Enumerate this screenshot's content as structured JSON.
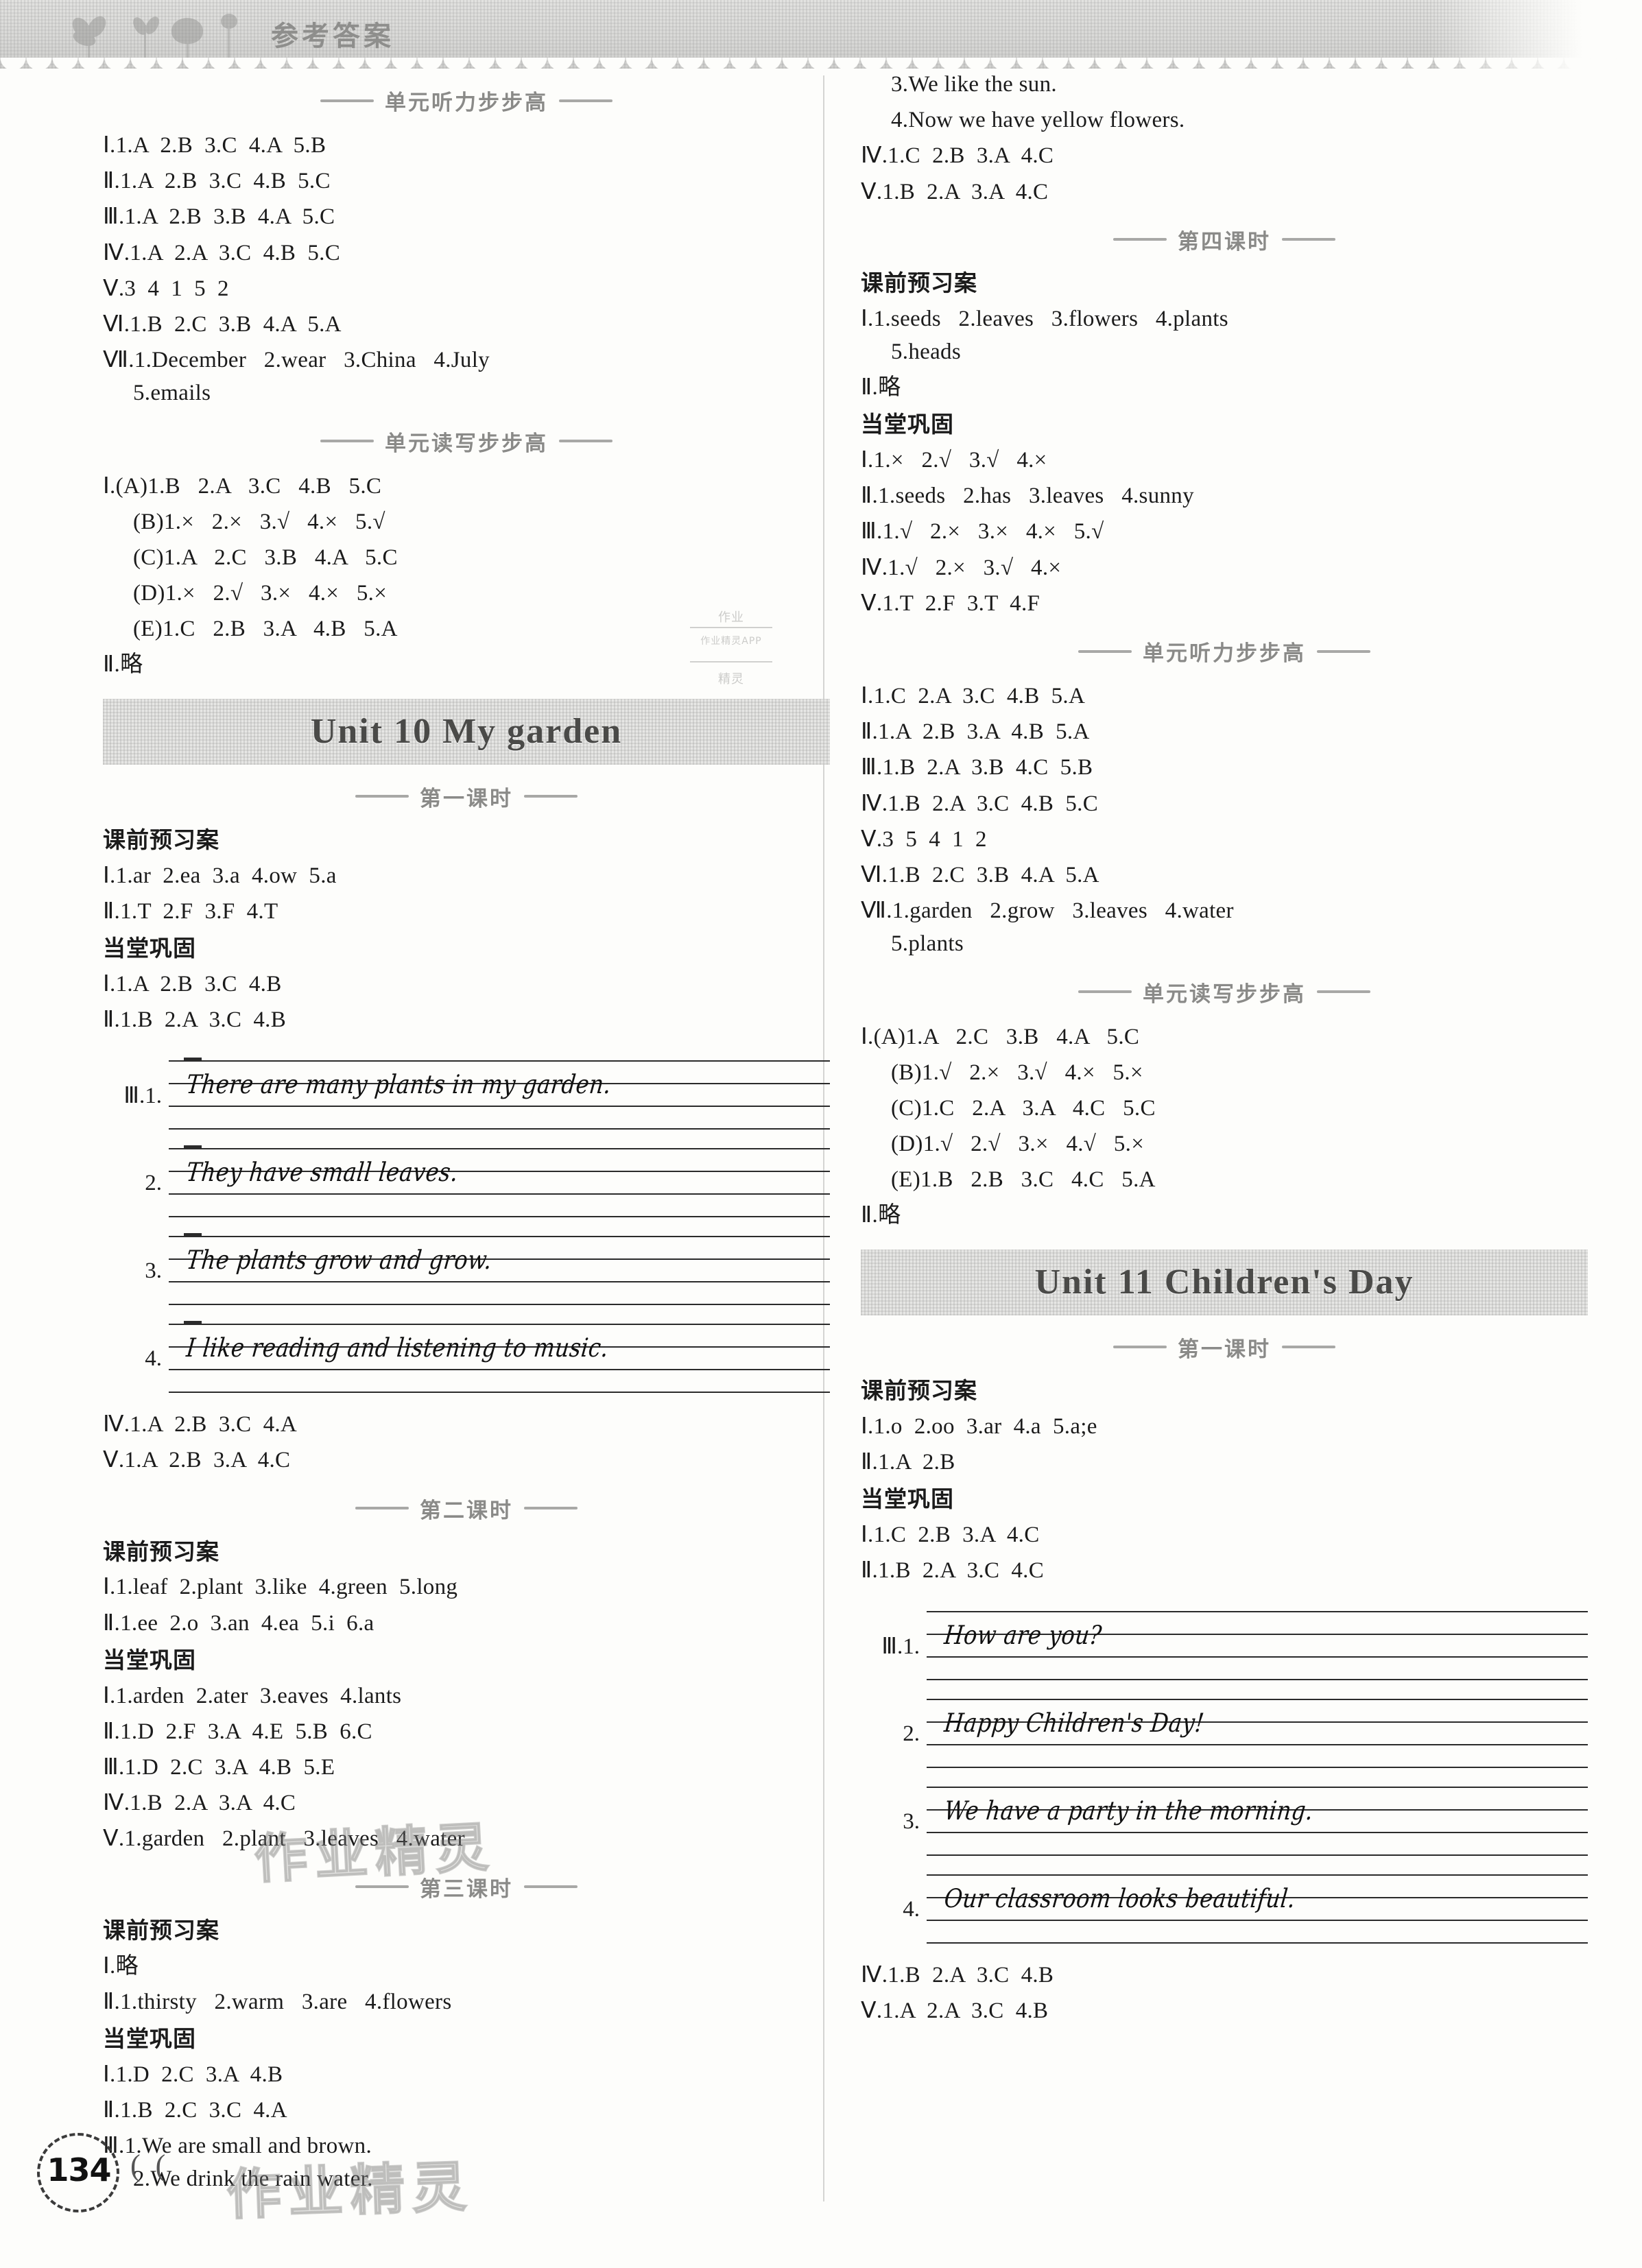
{
  "band": {
    "title": "参考答案"
  },
  "page_number": "134",
  "section_headings": {
    "listening": "单元听力步步高",
    "reading_writing": "单元读写步步高",
    "lesson1": "第一课时",
    "lesson2": "第二课时",
    "lesson3": "第三课时",
    "lesson4": "第四课时"
  },
  "labels": {
    "preview": "课前预习案",
    "consolidate": "当堂巩固"
  },
  "units": {
    "unit10": "Unit 10   My garden",
    "unit11": "Unit 11   Children's Day"
  },
  "left_column": {
    "listening_block": [
      "Ⅰ.1.A  2.B  3.C  4.A  5.B",
      "Ⅱ.1.A  2.B  3.C  4.B  5.C",
      "Ⅲ.1.A  2.B  3.B  4.A  5.C",
      "Ⅳ.1.A  2.A  3.C  4.B  5.C",
      "Ⅴ.3  4  1  5  2",
      "Ⅵ.1.B  2.C  3.B  4.A  5.A",
      "Ⅶ.1.December   2.wear   3.China   4.July"
    ],
    "listening_block_cont": "5.emails",
    "reading_block": [
      "Ⅰ.(A)1.B   2.A   3.C   4.B   5.C",
      "(B)1.×   2.×   3.√   4.×   5.√",
      "(C)1.A   2.C   3.B   4.A   5.C",
      "(D)1.×   2.√   3.×   4.×   5.×",
      "(E)1.C   2.B   3.A   4.B   5.A"
    ],
    "reading_block_tail": "Ⅱ.略",
    "u10_l1_preview": [
      "Ⅰ.1.ar  2.ea  3.a  4.ow  5.a",
      "Ⅱ.1.T  2.F  3.F  4.T"
    ],
    "u10_l1_consolidate": [
      "Ⅰ.1.A  2.B  3.C  4.B",
      "Ⅱ.1.B  2.A  3.C  4.B"
    ],
    "u10_l1_writing_marker": "Ⅲ.1.",
    "u10_l1_writing": [
      {
        "num": "Ⅲ.1.",
        "text": "There are many plants in my garden."
      },
      {
        "num": "2.",
        "text": "They have small leaves."
      },
      {
        "num": "3.",
        "text": "The plants grow and grow."
      },
      {
        "num": "4.",
        "text": "I like reading and listening to music."
      }
    ],
    "u10_l1_after": [
      "Ⅳ.1.A  2.B  3.C  4.A",
      "Ⅴ.1.A  2.B  3.A  4.C"
    ],
    "u10_l2_preview": [
      "Ⅰ.1.leaf  2.plant  3.like  4.green  5.long",
      "Ⅱ.1.ee  2.o  3.an  4.ea  5.i  6.a"
    ],
    "u10_l2_consolidate": [
      "Ⅰ.1.arden  2.ater  3.eaves  4.lants",
      "Ⅱ.1.D  2.F  3.A  4.E  5.B  6.C",
      "Ⅲ.1.D  2.C  3.A  4.B  5.E",
      "Ⅳ.1.B  2.A  3.A  4.C",
      "Ⅴ.1.garden   2.plant   3.leaves   4.water"
    ],
    "u10_l3_preview": [
      "Ⅰ.略",
      "Ⅱ.1.thirsty   2.warm   3.are   4.flowers"
    ],
    "u10_l3_consolidate": [
      "Ⅰ.1.D  2.C  3.A  4.B",
      "Ⅱ.1.B  2.C  3.C  4.A",
      "Ⅲ.1.We are small and brown."
    ],
    "u10_l3_consolidate_cont": "2.We drink the rain water."
  },
  "right_column": {
    "u10_l3_cont": [
      "3.We like the sun.",
      "4.Now we have yellow flowers."
    ],
    "u10_l3_tail": [
      "Ⅳ.1.C  2.B  3.A  4.C",
      "Ⅴ.1.B  2.A  3.A  4.C"
    ],
    "u10_l4_preview": [
      "Ⅰ.1.seeds   2.leaves   3.flowers   4.plants",
      "5.heads",
      "Ⅱ.略"
    ],
    "u10_l4_consolidate": [
      "Ⅰ.1.×   2.√   3.√   4.×",
      "Ⅱ.1.seeds   2.has   3.leaves   4.sunny",
      "Ⅲ.1.√   2.×   3.×   4.×   5.√",
      "Ⅳ.1.√   2.×   3.√   4.×",
      "Ⅴ.1.T  2.F  3.T  4.F"
    ],
    "u10_listening": [
      "Ⅰ.1.C  2.A  3.C  4.B  5.A",
      "Ⅱ.1.A  2.B  3.A  4.B  5.A",
      "Ⅲ.1.B  2.A  3.B  4.C  5.B",
      "Ⅳ.1.B  2.A  3.C  4.B  5.C",
      "Ⅴ.3  5  4  1  2",
      "Ⅵ.1.B  2.C  3.B  4.A  5.A",
      "Ⅶ.1.garden   2.grow   3.leaves   4.water"
    ],
    "u10_listening_cont": "5.plants",
    "u10_reading": [
      "Ⅰ.(A)1.A   2.C   3.B   4.A   5.C",
      "(B)1.√   2.×   3.√   4.×   5.×",
      "(C)1.C   2.A   3.A   4.C   5.C",
      "(D)1.√   2.√   3.×   4.√   5.×",
      "(E)1.B   2.B   3.C   4.C   5.A"
    ],
    "u10_reading_tail": "Ⅱ.略",
    "u11_l1_preview": [
      "Ⅰ.1.o  2.oo  3.ar  4.a  5.a;e",
      "Ⅱ.1.A  2.B"
    ],
    "u11_l1_consolidate": [
      "Ⅰ.1.C  2.B  3.A  4.C",
      "Ⅱ.1.B  2.A  3.C  4.C"
    ],
    "u11_l1_writing": [
      {
        "num": "Ⅲ.1.",
        "text": "How are you?"
      },
      {
        "num": "2.",
        "text": "Happy Children's Day!"
      },
      {
        "num": "3.",
        "text": "We have a party in the morning."
      },
      {
        "num": "4.",
        "text": "Our classroom looks beautiful."
      }
    ],
    "u11_l1_after": [
      "Ⅳ.1.B  2.A  3.C  4.B",
      "Ⅴ.1.A  2.A  3.C  4.B"
    ]
  },
  "watermark": {
    "text": "作业精灵"
  },
  "stamp": {
    "line1": "作业",
    "line2": "作业精灵APP",
    "line3": "精灵"
  }
}
